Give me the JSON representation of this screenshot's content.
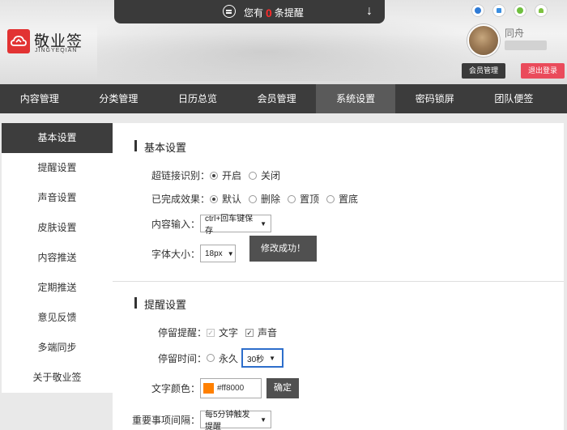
{
  "notification": {
    "prefix": "您有",
    "count": "0",
    "suffix": "条提醒"
  },
  "brand": {
    "name": "敬业签",
    "pinyin": "JINGYEQIAN"
  },
  "platform_icons": [
    "ie-icon",
    "windows-icon",
    "apple-icon",
    "android-icon"
  ],
  "user": {
    "name": "同舟",
    "member_btn": "会员管理",
    "logout_btn": "退出登录"
  },
  "nav": [
    "内容管理",
    "分类管理",
    "日历总览",
    "会员管理",
    "系统设置",
    "密码锁屏",
    "团队便签"
  ],
  "nav_active": "系统设置",
  "sidebar": [
    "基本设置",
    "提醒设置",
    "声音设置",
    "皮肤设置",
    "内容推送",
    "定期推送",
    "意见反馈",
    "多端同步",
    "关于敬业签"
  ],
  "sidebar_active": "基本设置",
  "basic": {
    "title": "基本设置",
    "hyperlink": {
      "label": "超链接识别：",
      "on": "开启",
      "off": "关闭"
    },
    "completed": {
      "label": "已完成效果：",
      "options": [
        "默认",
        "删除",
        "置顶",
        "置底"
      ]
    },
    "input": {
      "label": "内容输入：",
      "value": "ctrl+回车键保存"
    },
    "font": {
      "label": "字体大小：",
      "value": "18px"
    },
    "save_btn": "修改成功！"
  },
  "reminder": {
    "title": "提醒设置",
    "stay": {
      "label": "停留提醒：",
      "text": "文字",
      "sound": "声音"
    },
    "stay_time": {
      "label": "停留时间：",
      "forever": "永久",
      "value": "30秒"
    },
    "text_color": {
      "label": "文字颜色：",
      "value": "#ff8000",
      "confirm": "确定"
    },
    "interval": {
      "label": "重要事项间隔：",
      "value": "每5分钟触发提醒"
    }
  },
  "colors": {
    "accent": "#ff8000",
    "logo_red": "#e23333",
    "logout_red": "#ea4b5b",
    "nav_bg": "#3c3c3c"
  }
}
